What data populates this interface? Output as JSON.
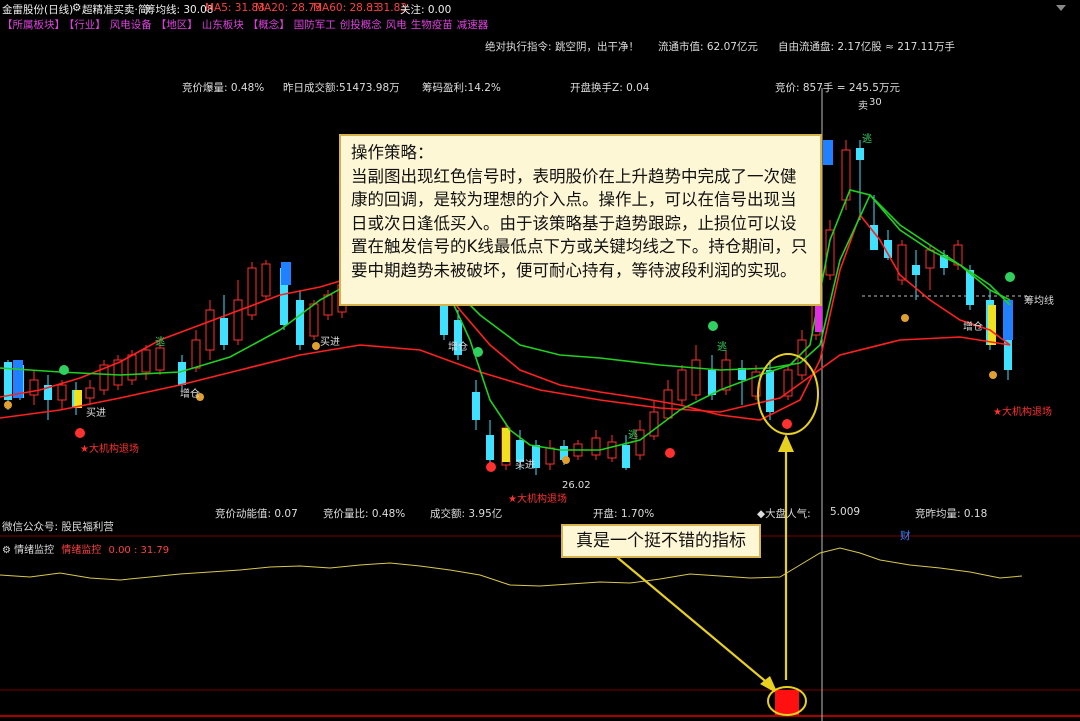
{
  "topbar": {
    "stock": "金雷股份(日线)",
    "indicator": "超精准买卖·简",
    "chip_label": "筹均线: 30.08",
    "ma5": "MA5: 31.83",
    "ma20": "MA20: 28.73",
    "ma60": "MA60: 28.83",
    "price": ": 31.83",
    "focus": "关注: 0.00"
  },
  "sectors": [
    "【所属板块】",
    "【行业】",
    "风电设备",
    "【地区】",
    "山东板块",
    "【概念】",
    "国防军工",
    "创投概念",
    "风电",
    "生物疫苗",
    "减速器"
  ],
  "info_row1": {
    "cmd_label": "绝对执行指令:",
    "cmd_value": "跳空阴，出干净！",
    "float_mv": "流通市值: 62.07亿元",
    "free_float": "自由流通盘: 2.17亿股 ≈ 217.11万手"
  },
  "info_row2": {
    "bid_vol_ratio": "竞价爆量: 0.48%",
    "yesterday_turnover": "昨日成交额:51473.98万",
    "chip_profit": "筹码盈利:14.2%",
    "open_turnover": "开盘换手Z: 0.04",
    "bid": "竞价: 857手 = 245.5万元"
  },
  "bottom_info": {
    "wechat": "微信公众号: 股民福利营",
    "bid_momentum": "竞价动能值: 0.07",
    "bid_ratio": "竞价量比: 0.48%",
    "turnover": "成交额: 3.95亿",
    "open": "开盘: 1.70%",
    "market_mood_label": "◆大盘人气:",
    "market_mood_value": "5.009",
    "bid_avg": "竞昨均量: 0.18",
    "cai": "财"
  },
  "sub_panel": {
    "title": "情绪监控",
    "label": "情绪监控",
    "values": "0.00 : 31.79"
  },
  "annotations": {
    "strategy_text": "操作策略：\n当副图出现红色信号时，表明股价在上升趋势中完成了一次健康的回调，是较为理想的介入点。操作上，可以在信号出现当日或次日逢低买入。由于该策略基于趋势跟踪，止损位可以设置在触发信号的K线最低点下方或关键均线之下。持仓期间，只要中期趋势未被破坏，便可耐心持有，等待波段利润的实现。",
    "callout": "真是一个挺不错的指标"
  },
  "chart_labels": {
    "high": "30",
    "low": "26.02",
    "chip_line": "筹均线",
    "buy": "买进",
    "add": "增仓",
    "escape": "逃",
    "exit": "★大机构退场",
    "sell": "卖"
  },
  "colors": {
    "up": "#ff3030",
    "down": "#40e0ff",
    "ma_red": "#ff2020",
    "ma_green": "#20d020",
    "callout_border": "#d6b24a",
    "arrow": "#e8d020",
    "sector": "#e040e0"
  }
}
